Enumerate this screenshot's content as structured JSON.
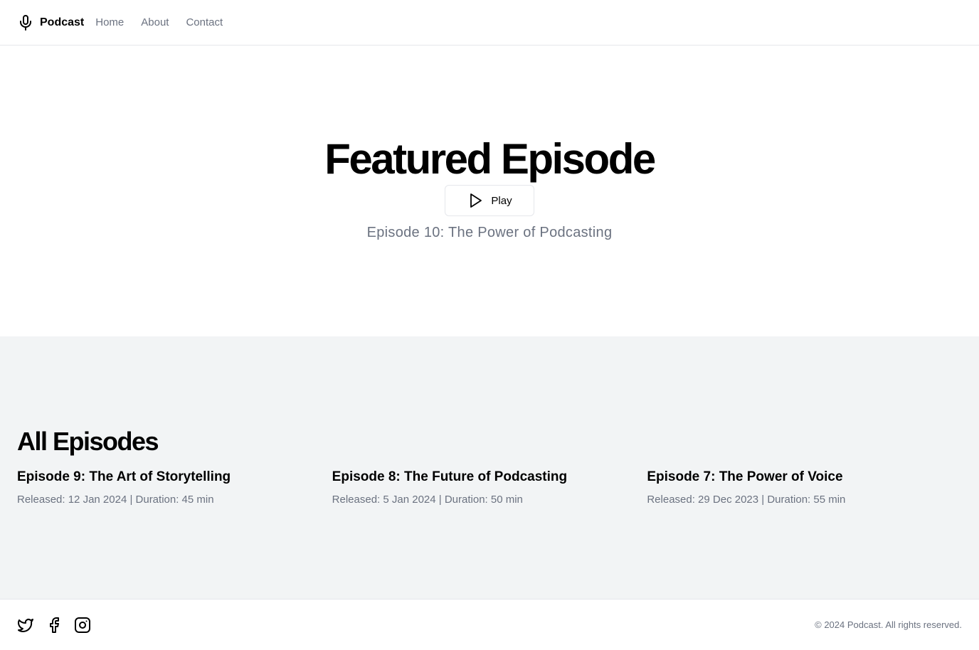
{
  "header": {
    "brand": {
      "icon": "microphone-icon",
      "name": "Podcast"
    },
    "nav": [
      {
        "label": "Home"
      },
      {
        "label": "About"
      },
      {
        "label": "Contact"
      }
    ]
  },
  "hero": {
    "title": "Featured Episode",
    "play_button": {
      "icon": "play-icon",
      "label": "Play"
    },
    "subtitle": "Episode 10: The Power of Podcasting"
  },
  "episodes": {
    "title": "All Episodes",
    "items": [
      {
        "title": "Episode 9: The Art of Storytelling",
        "meta": "Released: 12 Jan 2024 | Duration: 45 min"
      },
      {
        "title": "Episode 8: The Future of Podcasting",
        "meta": "Released: 5 Jan 2024 | Duration: 50 min"
      },
      {
        "title": "Episode 7: The Power of Voice",
        "meta": "Released: 29 Dec 2023 | Duration: 55 min"
      }
    ]
  },
  "footer": {
    "socials": [
      {
        "icon": "twitter-icon"
      },
      {
        "icon": "facebook-icon"
      },
      {
        "icon": "instagram-icon"
      }
    ],
    "copyright": "© 2024 Podcast. All rights reserved."
  },
  "colors": {
    "muted_text": "#6b7280",
    "border": "#e5e7eb",
    "section_bg": "#f2f4f5"
  }
}
